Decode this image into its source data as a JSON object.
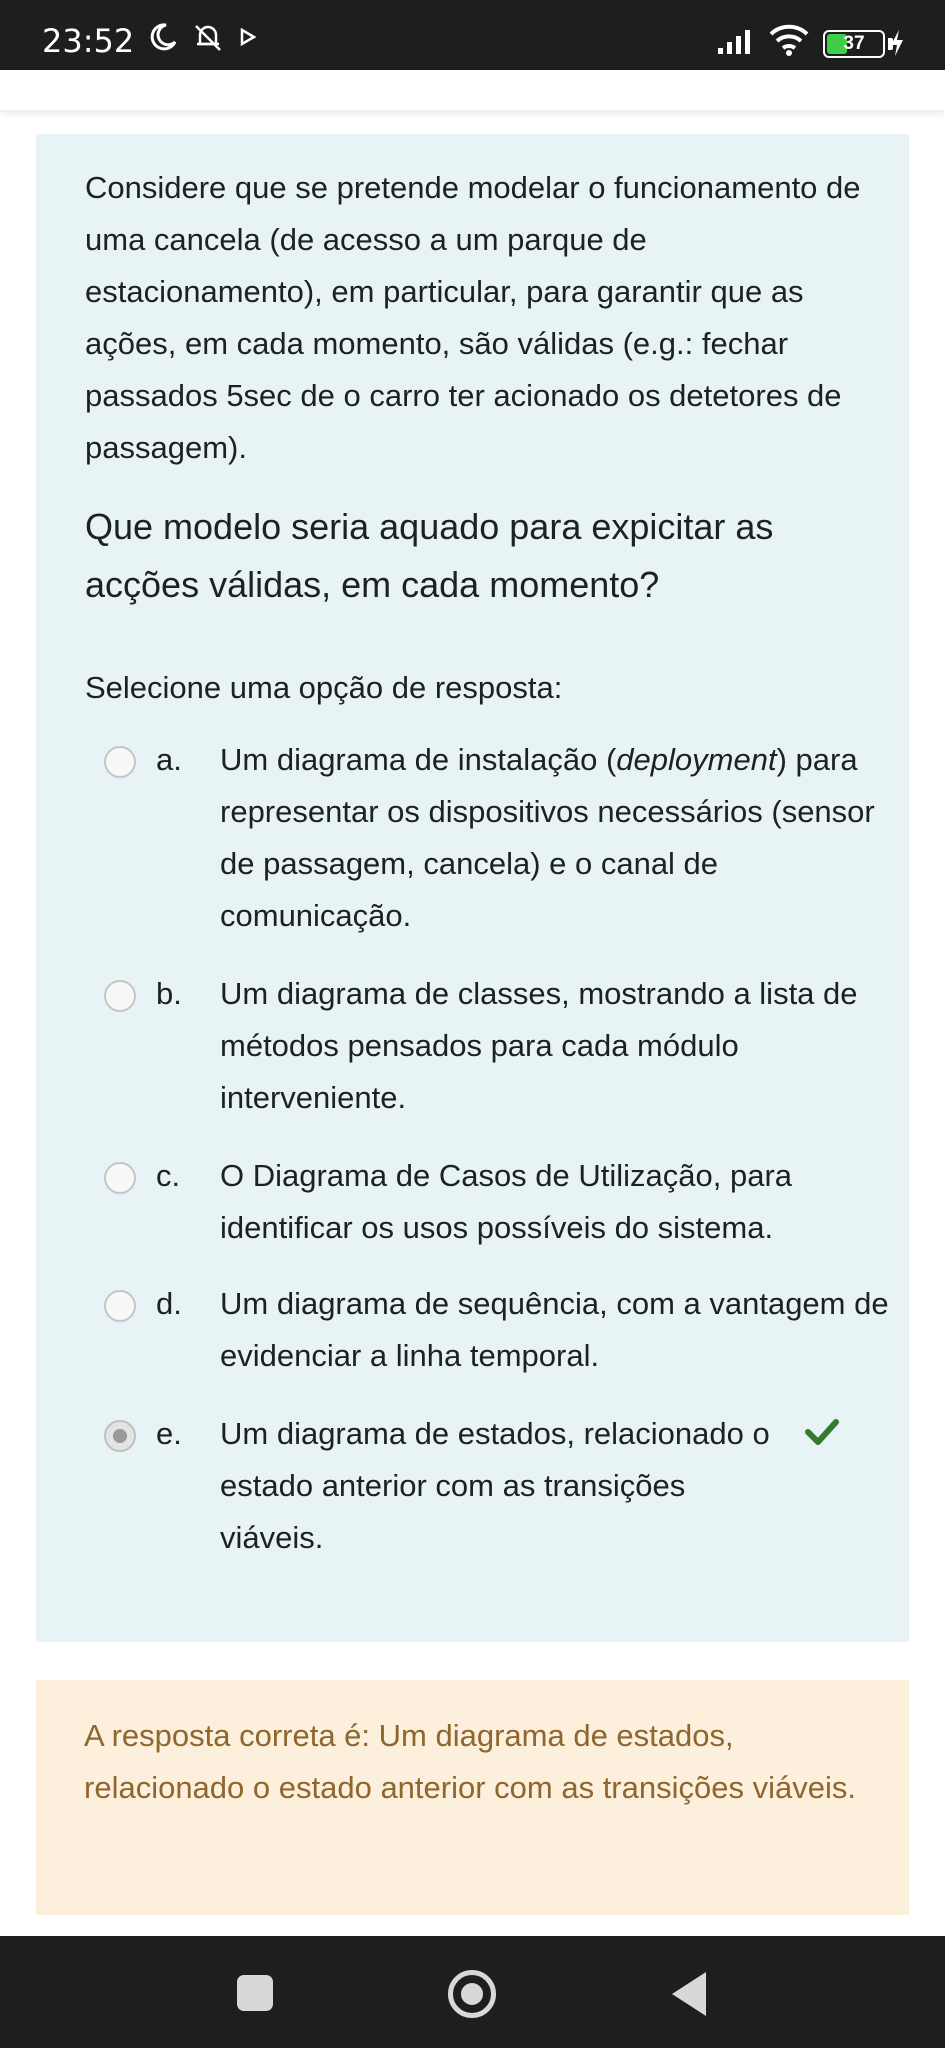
{
  "status_bar": {
    "time": "23:52",
    "battery": "37",
    "battery_level": 0.37,
    "icons_left": [
      "moon-icon",
      "muted-bell-icon",
      "play-icon"
    ],
    "icons_right": [
      "signal-icon",
      "wifi-icon",
      "battery-icon",
      "charging-icon"
    ]
  },
  "question": {
    "paragraph1": "Considere que se pretende modelar o funcionamento de uma cancela (de acesso a um parque de estacionamento), em particular, para garantir que as ações, em cada momento, são válidas (e.g.: fechar passados 5sec de o carro ter acionado os detetores de passagem).",
    "paragraph2": "Que modelo seria aquado para expicitar as acções válidas, em cada momento?",
    "prompt": "Selecione uma opção de resposta:",
    "options": [
      {
        "letter": "a.",
        "text_before": "Um diagrama de instalação (",
        "text_italic": "deployment",
        "text_after": ") para representar os dispositivos necessários (sensor de passagem, cancela) e o canal de comunicação.",
        "selected": false
      },
      {
        "letter": "b.",
        "text": "Um diagrama de classes, mostrando a lista de métodos pensados para cada módulo interveniente.",
        "selected": false
      },
      {
        "letter": "c.",
        "text": "O Diagrama de Casos de Utilização, para identificar os usos possíveis do sistema.",
        "selected": false
      },
      {
        "letter": "d.",
        "text": "Um diagrama de sequência, com a vantagem de evidenciar a linha temporal.",
        "selected": false
      },
      {
        "letter": "e.",
        "text": "Um diagrama de estados, relacionado o estado anterior com as transições viáveis.",
        "selected": true,
        "correct": true
      }
    ]
  },
  "feedback": {
    "text": "A resposta correta é: Um diagrama de estados, relacionado o estado anterior com as transições viáveis."
  },
  "colors": {
    "question_bg": "#e7f3f5",
    "feedback_bg": "#fcefdc",
    "feedback_text": "#8e662e",
    "check_green": "#357a32"
  }
}
